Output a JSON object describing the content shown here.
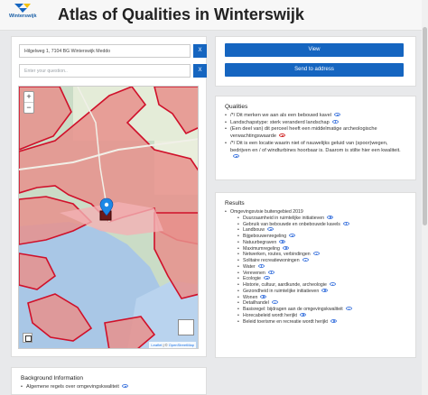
{
  "header": {
    "logo_text": "Winterswijk",
    "title": "Atlas of Qualities in Winterswijk"
  },
  "search": {
    "address_value": "Hilgelweg 1, 7104 BG Winterswijk Meddo",
    "question_placeholder": "Enter your question..",
    "clear_label": "X"
  },
  "actions": {
    "view_label": "View",
    "send_label": "Send to address"
  },
  "map": {
    "zoom_in": "+",
    "zoom_out": "−",
    "attribution_leaflet": "Leaflet",
    "attribution_sep": " | © ",
    "attribution_osm": "OpenStreetMap"
  },
  "qualities": {
    "title": "Qualities",
    "items": [
      {
        "text": "/*/ Dit merken we aan als een bebouwd kavel",
        "eye": "blue"
      },
      {
        "text": "Landschapstype: sterk veranderd landschap",
        "eye": "blue"
      },
      {
        "text": "(Een deel van) dit perceel heeft een middelmatige archeologische verwachtingswaarde",
        "eye": "red"
      },
      {
        "text": "/*/ Dit is een locatie waarin niet of nauwelijks geluid van (spoor)wegen, bedrijven en / of windturbines hoorbaar is. Daarom is stilte hier een kwaliteit.",
        "eye": "blue"
      }
    ]
  },
  "results": {
    "title": "Results",
    "group": "Omgevingsvisie buitengebied 2019",
    "items": [
      "Duurzaamheid in ruimtelijke initiatieven",
      "Gebruik van bebouwde en onbebouwde kavels",
      "Landbouw",
      "Bijgebouwenregeling",
      "Natuurbegraven",
      "Maximumregeling",
      "Netwerken, routes, verbindingen",
      "Solitaire recreatiewoningen",
      "Water",
      "Verevenen",
      "Ecologie",
      "Historie, cultuur, aardkunde, archeologie",
      "Gezondheid in ruimtelijke initiatieven",
      "Wonen",
      "Detailhandel",
      "Basisregel: bijdragen aan de omgevingskwaliteit",
      "Horecabeleid wordt herijkt",
      "Beleid toerisme en recreatie wordt herijkt"
    ]
  },
  "background": {
    "title": "Background Information",
    "items": [
      "Algemene regels over omgevingskwaliteit"
    ]
  },
  "colors": {
    "primary": "#1565c0",
    "zone_fill": "#e8908c",
    "zone_stroke": "#d0102a",
    "water": "#a9c7e6",
    "meadow": "#c8dcc4",
    "marker": "#1e88e5"
  }
}
